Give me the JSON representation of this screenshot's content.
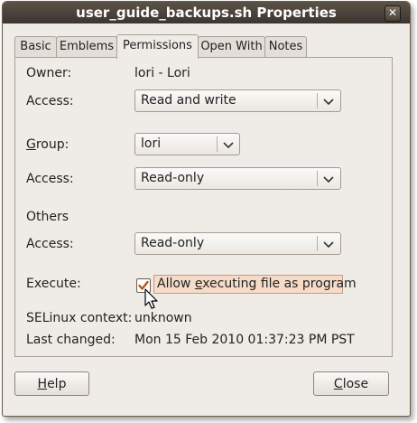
{
  "window": {
    "title": "user_guide_backups.sh Properties",
    "close_glyph": "✕"
  },
  "tabs": [
    {
      "label": "Basic"
    },
    {
      "label": "Emblems"
    },
    {
      "label": "Permissions"
    },
    {
      "label": "Open With"
    },
    {
      "label": "Notes"
    }
  ],
  "active_tab": "Permissions",
  "permissions": {
    "owner_label": "Owner:",
    "owner_value": "lori - Lori",
    "owner_access_label": "Access:",
    "owner_access_value": "Read and write",
    "group_label_pre": "",
    "group_label_ul": "G",
    "group_label_post": "roup:",
    "group_value": "lori",
    "group_access_label": "Access:",
    "group_access_value": "Read-only",
    "others_heading": "Others",
    "others_access_label": "Access:",
    "others_access_value": "Read-only",
    "execute_label": "Execute:",
    "execute_checked": true,
    "execute_option_pre": "Allow ",
    "execute_option_ul": "e",
    "execute_option_post": "xecuting file as program",
    "selinux_label": "SELinux context:",
    "selinux_value": "unknown",
    "last_changed_label": "Last changed:",
    "last_changed_value": "Mon 15 Feb 2010 01:37:23 PM PST"
  },
  "buttons": {
    "help_ul": "H",
    "help_rest": "elp",
    "close_ul": "C",
    "close_rest": "lose"
  },
  "icons": {
    "dropdown": "chevron-down-icon",
    "check": "checkmark-icon",
    "cursor": "mouse-pointer-icon"
  },
  "colors": {
    "titlebar": "#4a4139",
    "dialog_bg": "#efebe7",
    "focus_highlight": "#f6dcc8",
    "focus_border": "#d19a72",
    "checkmark": "#b8541d"
  }
}
